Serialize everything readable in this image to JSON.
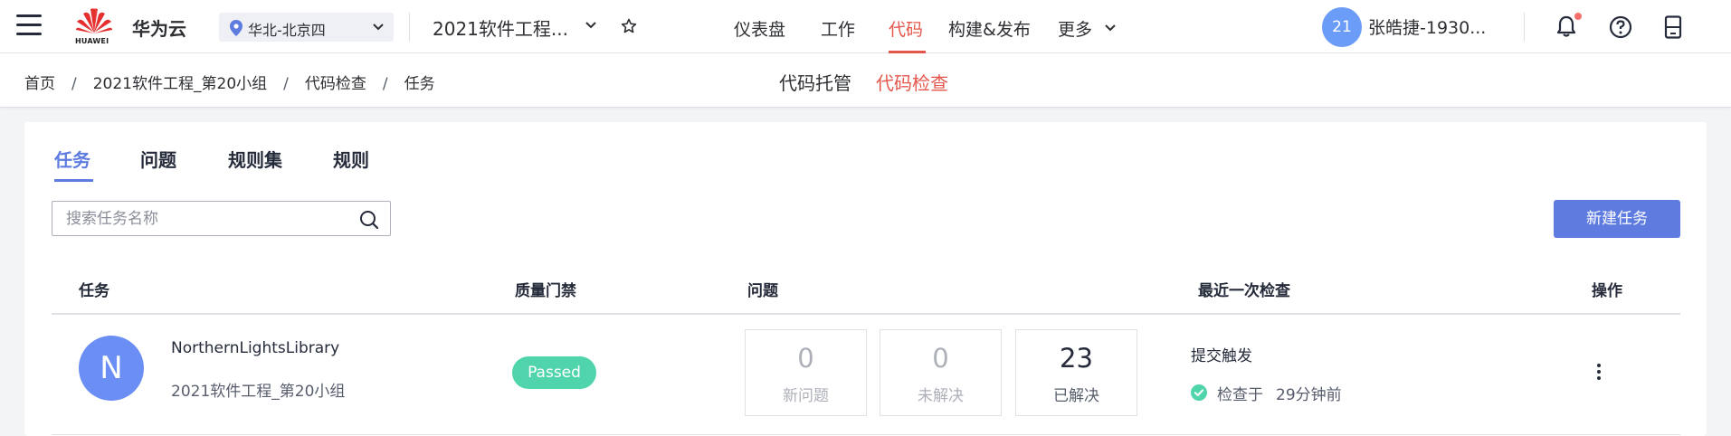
{
  "header": {
    "brand": "华为云",
    "logo_text": "HUAWEI",
    "region": "华北-北京四",
    "project": "2021软件工程...",
    "nav": [
      "仪表盘",
      "工作",
      "代码",
      "构建&发布",
      "更多"
    ],
    "active_nav": "代码",
    "user": {
      "avatar_text": "21",
      "name": "张皓捷-1930..."
    }
  },
  "subbar": {
    "breadcrumbs": [
      "首页",
      "2021软件工程_第20小组",
      "代码检查",
      "任务"
    ],
    "subnav": [
      "代码托管",
      "代码检查"
    ],
    "active_subnav": "代码检查"
  },
  "tabs": [
    "任务",
    "问题",
    "规则集",
    "规则"
  ],
  "active_tab": "任务",
  "search": {
    "placeholder": "搜索任务名称"
  },
  "new_task_button": "新建任务",
  "table": {
    "headers": [
      "任务",
      "质量门禁",
      "问题",
      "最近一次检查",
      "操作"
    ],
    "rows": [
      {
        "avatar_letter": "N",
        "name": "NorthernLightsLibrary",
        "project": "2021软件工程_第20小组",
        "quality_gate": "Passed",
        "issues": [
          {
            "value": "0",
            "label": "新问题"
          },
          {
            "value": "0",
            "label": "未解决"
          },
          {
            "value": "23",
            "label": "已解决"
          }
        ],
        "trigger": "提交触发",
        "checked_label": "检查于",
        "checked_time": "29分钟前"
      }
    ]
  },
  "colors": {
    "accent": "#5e7ce0",
    "nav_active": "#e4574c",
    "passed": "#50d4ab",
    "avatar": "#6b8ef5"
  }
}
